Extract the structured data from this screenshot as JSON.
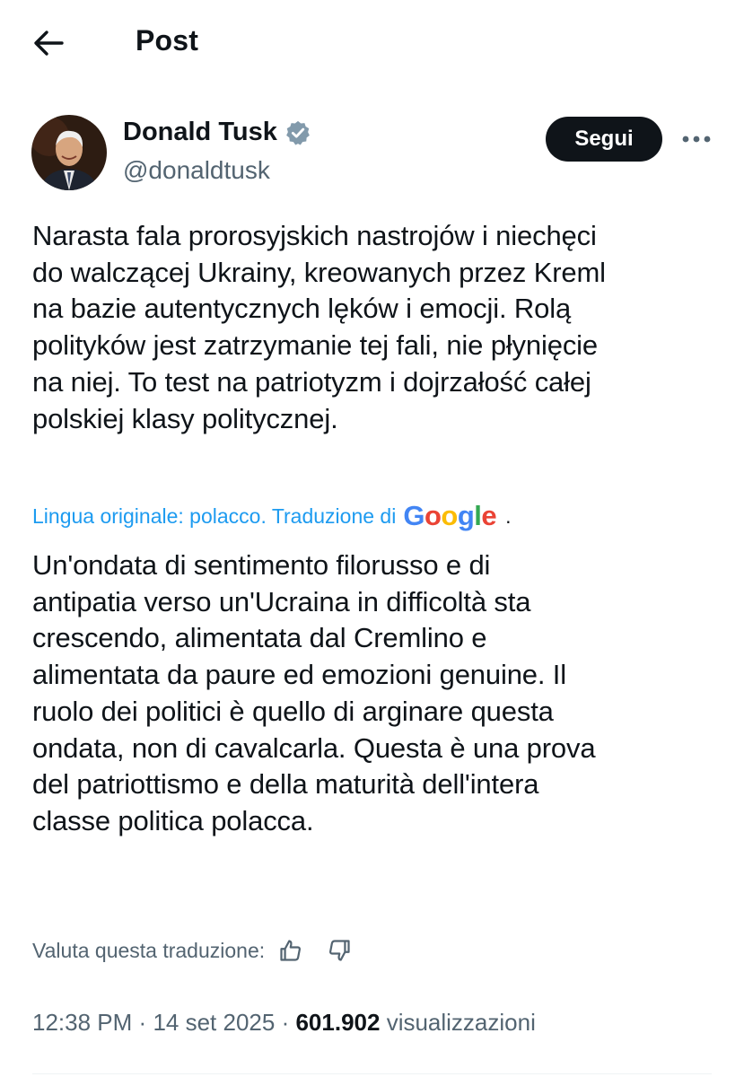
{
  "header": {
    "title": "Post"
  },
  "author": {
    "name": "Donald Tusk",
    "handle": "@donaldtusk",
    "follow_label": "Segui"
  },
  "post": {
    "text": "Narasta fala prorosyjskich nastrojów i niechęci\ndo walczącej Ukrainy, kreowanych przez Kreml\nna bazie autentycznych lęków i emocji. Rolą\npolityków jest zatrzymanie tej fali, nie płynięcie\nna niej. To test na patriotyzm i dojrzałość całej\npolskiej klasy politycznej."
  },
  "translation": {
    "note": "Lingua originale: polacco. Traduzione di",
    "provider": "Google",
    "dot": ".",
    "text": "Un'ondata di sentimento filorusso e di\nantipatia verso un'Ucraina in difficoltà sta\ncrescendo, alimentata dal Cremlino e\nalimentata da paure ed emozioni genuine. Il\nruolo dei politici è quello di arginare questa\nondata, non di cavalcarla. Questa è una prova\ndel patriottismo e della maturità dell'intera\nclasse politica polacca.",
    "rate_label": "Valuta questa traduzione:"
  },
  "meta": {
    "time": "12:38 PM",
    "sep1": "·",
    "date": "14 set 2025",
    "sep2": "·",
    "views_count": "601.902",
    "views_label": "visualizzazioni"
  },
  "colors": {
    "link": "#1d9bf0",
    "verified": "#829aab",
    "secondary_text": "#536471",
    "follow_bg": "#0f1419"
  },
  "icons": [
    "back-arrow-icon",
    "verified-badge-icon",
    "more-options-icon",
    "thumbs-up-icon",
    "thumbs-down-icon"
  ]
}
